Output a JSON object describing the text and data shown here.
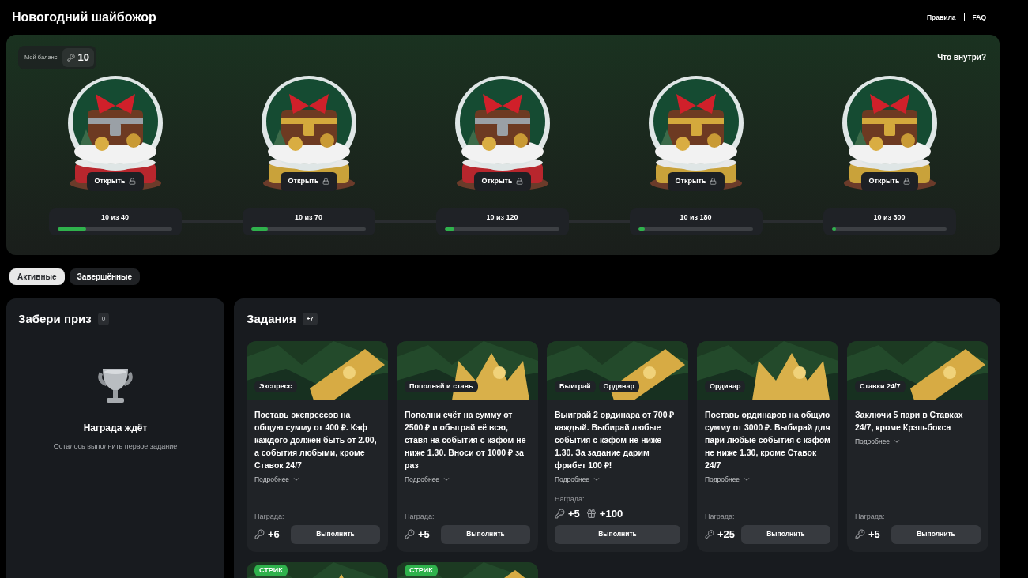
{
  "page_title": "Новогодний шайбожор",
  "header_links": [
    {
      "label": "Правила"
    },
    {
      "label": "FAQ"
    }
  ],
  "balance": {
    "label": "Мой баланс:",
    "value": "10"
  },
  "whats_inside": "Что внутри?",
  "boxes": [
    {
      "button": "Открыть",
      "locked": true,
      "progress": "10 из 40",
      "level": 0.25
    },
    {
      "button": "Открыть",
      "locked": true,
      "progress": "10 из 70",
      "level": 0.143
    },
    {
      "button": "Открыть",
      "locked": true,
      "progress": "10 из 120",
      "level": 0.083
    },
    {
      "button": "Открыть",
      "locked": true,
      "progress": "10 из 180",
      "level": 0.056
    },
    {
      "button": "Открыть",
      "locked": true,
      "progress": "10 из 300",
      "level": 0.033
    }
  ],
  "tabs": [
    {
      "label": "Активные",
      "selected": true
    },
    {
      "label": "Завершённые",
      "selected": false
    }
  ],
  "prize_panel": {
    "title": "Забери приз",
    "count": "0",
    "heading": "Награда ждёт",
    "subtitle": "Осталось выполнить первое задание"
  },
  "tasks_panel": {
    "title": "Задания",
    "count": "+7",
    "tasks": [
      {
        "tags": [
          {
            "label": "Экспресс",
            "kind": "category"
          }
        ],
        "description": "Поставь экспрессов на общую сумму от 400 ₽. Кэф каждого должен быть от 2.00, а события любыми, кроме Ставок 24/7",
        "more": "Подробнее",
        "reward_label": "Награда:",
        "rewards": [
          {
            "kind": "key",
            "value": "+6"
          }
        ],
        "button": "Выполнить"
      },
      {
        "tags": [
          {
            "label": "Пополняй и ставь",
            "kind": "category"
          }
        ],
        "description": "Пополни счёт на сумму от 2500 ₽ и обыграй её всю, ставя на события с кэфом не ниже 1.30. Вноси от 1000 ₽ за раз",
        "more": "Подробнее",
        "reward_label": "Награда:",
        "rewards": [
          {
            "kind": "key",
            "value": "+5"
          }
        ],
        "button": "Выполнить"
      },
      {
        "tags": [
          {
            "label": "Выиграй",
            "kind": "category"
          },
          {
            "label": "Ординар",
            "kind": "category"
          }
        ],
        "description": "Выиграй 2 ординара от 700 ₽ каждый. Выбирай любые события с кэфом не ниже 1.30. За задание дарим фрибет 100 ₽!",
        "more": "Подробнее",
        "reward_label": "Награда:",
        "rewards": [
          {
            "kind": "key",
            "value": "+5"
          },
          {
            "kind": "gift",
            "value": "+100"
          }
        ],
        "button": "Выполнить"
      },
      {
        "tags": [
          {
            "label": "Ординар",
            "kind": "category"
          }
        ],
        "description": "Поставь ординаров на общую сумму от 3000 ₽. Выбирай для пари любые события с кэфом не ниже 1.30, кроме Ставок 24/7",
        "more": "Подробнее",
        "reward_label": "Награда:",
        "rewards": [
          {
            "kind": "key",
            "value": "+25"
          }
        ],
        "button": "Выполнить"
      },
      {
        "tags": [
          {
            "label": "Ставки 24/7",
            "kind": "category"
          }
        ],
        "description": "Заключи 5 пари в Ставках 24/7, кроме Крэш-бокса",
        "more": "Подробнее",
        "reward_label": "Награда:",
        "rewards": [
          {
            "kind": "key",
            "value": "+5"
          }
        ],
        "button": "Выполнить"
      }
    ],
    "more_tasks": [
      {
        "tags": [
          {
            "label": "СТРИК",
            "kind": "streak"
          }
        ]
      },
      {
        "tags": [
          {
            "label": "СТРИК",
            "kind": "streak"
          }
        ]
      }
    ]
  }
}
